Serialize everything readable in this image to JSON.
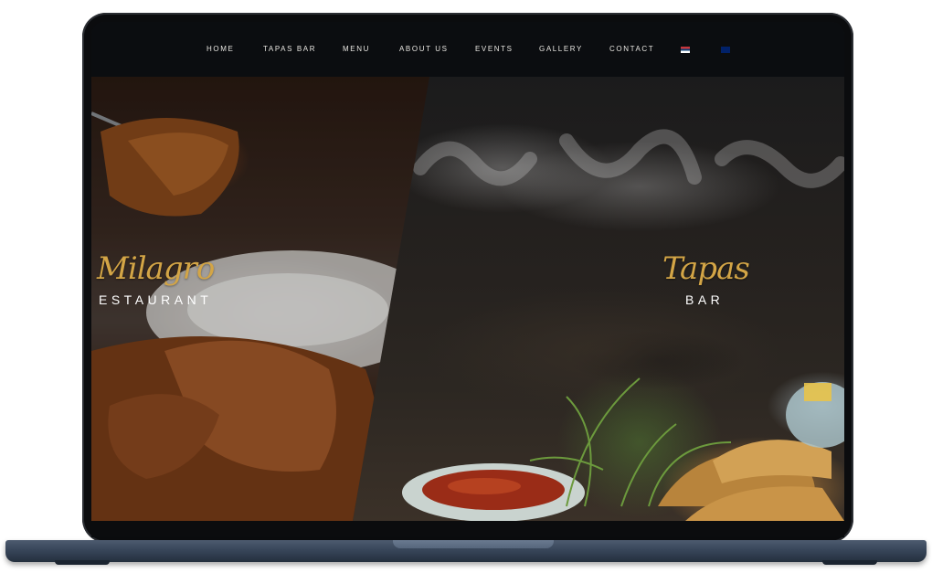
{
  "nav": {
    "items": [
      {
        "label": "HOME"
      },
      {
        "label": "TAPAS BAR"
      },
      {
        "label": "MENU"
      },
      {
        "label": "ABOUT US"
      },
      {
        "label": "EVENTS"
      },
      {
        "label": "GALLERY"
      },
      {
        "label": "CONTACT"
      }
    ],
    "flags": [
      "serbian-flag-icon",
      "uk-flag-icon"
    ]
  },
  "hero": {
    "left": {
      "script": "Milagro",
      "subtitle": "ESTAURANT"
    },
    "right": {
      "script": "Tapas",
      "subtitle": "BAR"
    }
  },
  "colors": {
    "nav_background": "#0b0d10",
    "nav_text": "#e8e6e1",
    "script_gold": "#d3a546",
    "subtitle_white": "#ffffff",
    "laptop_base": "#38465a"
  }
}
